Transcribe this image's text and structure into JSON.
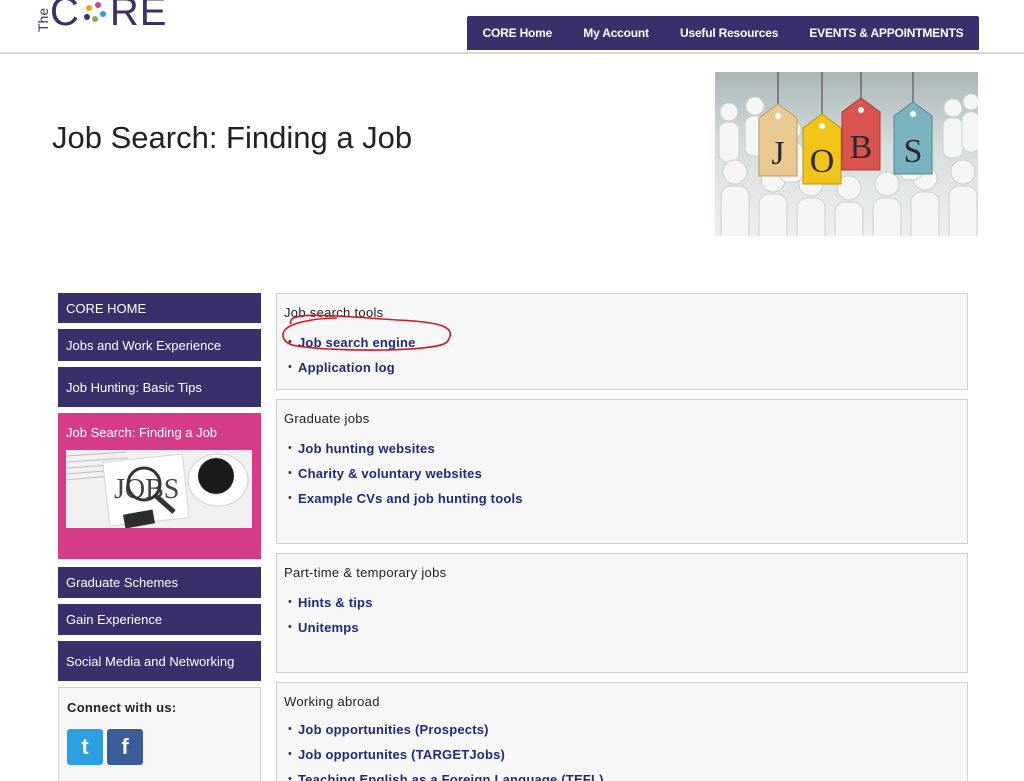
{
  "logo": {
    "prefix": "The",
    "word_start": "C",
    "word_end": "RE"
  },
  "nav": {
    "items": [
      {
        "label": "CORE Home"
      },
      {
        "label": "My Account"
      },
      {
        "label": "Useful Resources"
      },
      {
        "label": "EVENTS & APPOINTMENTS"
      }
    ]
  },
  "page": {
    "title": "Job Search: Finding a Job"
  },
  "hero": {
    "tags": [
      "J",
      "O",
      "B",
      "S"
    ]
  },
  "sidebar": {
    "items": [
      {
        "label": "CORE HOME"
      },
      {
        "label": "Jobs and Work Experience"
      },
      {
        "label": "Job Hunting: Basic Tips"
      }
    ],
    "active": {
      "label": "Job Search: Finding a Job",
      "thumb_text": "JOBS"
    },
    "items_after": [
      {
        "label": "Graduate Schemes"
      },
      {
        "label": "Gain Experience"
      },
      {
        "label": "Social Media and Networking"
      }
    ],
    "connect": {
      "title": "Connect with us:"
    },
    "social": {
      "twitter_glyph": "t",
      "facebook_glyph": "f",
      "twitter_color": "#2b9fe0",
      "facebook_color": "#3b5c9b"
    }
  },
  "panels": [
    {
      "title": "Job search tools",
      "links": [
        {
          "label": "Job search engine"
        },
        {
          "label": "Application log"
        }
      ]
    },
    {
      "title": "Graduate jobs",
      "links": [
        {
          "label": "Job hunting websites"
        },
        {
          "label": "Charity & voluntary websites"
        },
        {
          "label": "Example CVs and job hunting tools"
        }
      ]
    },
    {
      "title": "Part-time & temporary jobs",
      "links": [
        {
          "label": "Hints & tips"
        },
        {
          "label": "Unitemps"
        }
      ]
    },
    {
      "title": "Working abroad",
      "links": [
        {
          "label": "Job opportunities (Prospects)"
        },
        {
          "label": "Job opportunites (TARGETJobs)"
        },
        {
          "label": "Teaching English as a Foreign Language (TEFL)"
        }
      ]
    }
  ],
  "colors": {
    "brand_purple": "#3b2f6b",
    "active_pink": "#d63b88",
    "link_blue": "#1f2a7a",
    "annotation_red": "#d9141b"
  }
}
